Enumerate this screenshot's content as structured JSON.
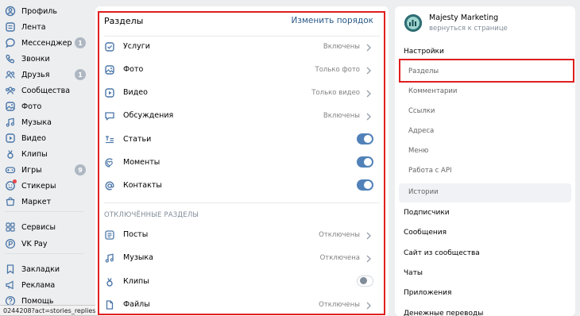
{
  "left_nav": {
    "items": [
      {
        "label": "Профиль",
        "icon": "user-circle-icon"
      },
      {
        "label": "Лента",
        "icon": "news-icon"
      },
      {
        "label": "Мессенджер",
        "icon": "message-icon",
        "badge": "1"
      },
      {
        "label": "Звонки",
        "icon": "phone-icon"
      },
      {
        "label": "Друзья",
        "icon": "friends-icon",
        "badge": "1"
      },
      {
        "label": "Сообщества",
        "icon": "communities-icon"
      },
      {
        "label": "Фото",
        "icon": "photo-icon"
      },
      {
        "label": "Музыка",
        "icon": "music-icon"
      },
      {
        "label": "Видео",
        "icon": "video-icon"
      },
      {
        "label": "Клипы",
        "icon": "clips-icon"
      },
      {
        "label": "Игры",
        "icon": "games-icon",
        "badge": "9"
      },
      {
        "label": "Стикеры",
        "icon": "stickers-icon"
      },
      {
        "label": "Маркет",
        "icon": "market-icon"
      },
      {
        "label": "Сервисы",
        "icon": "services-icon"
      },
      {
        "label": "VK Pay",
        "icon": "vkpay-icon"
      },
      {
        "label": "Закладки",
        "icon": "bookmark-icon"
      },
      {
        "label": "Реклама",
        "icon": "ads-icon"
      },
      {
        "label": "Помощь",
        "icon": "help-icon"
      }
    ]
  },
  "status_bar": {
    "text": "0244208?act=stories_replies"
  },
  "sections_panel": {
    "title": "Разделы",
    "action": "Изменить порядок",
    "enabled_rows": [
      {
        "label": "Услуги",
        "value": "Включены",
        "icon": "services-check-icon"
      },
      {
        "label": "Фото",
        "value": "Только фото",
        "icon": "photo-icon"
      },
      {
        "label": "Видео",
        "value": "Только видео",
        "icon": "video-icon"
      },
      {
        "label": "Обсуждения",
        "value": "Включены",
        "icon": "discussions-icon"
      },
      {
        "label": "Статьи",
        "toggle": true,
        "icon": "articles-icon"
      },
      {
        "label": "Моменты",
        "toggle": true,
        "icon": "moments-icon"
      },
      {
        "label": "Контакты",
        "toggle": true,
        "icon": "contacts-icon"
      }
    ],
    "disabled_title": "ОТКЛЮЧЁННЫЕ РАЗДЕЛЫ",
    "disabled_rows": [
      {
        "label": "Посты",
        "value": "Отключены",
        "icon": "posts-icon"
      },
      {
        "label": "Музыка",
        "value": "Отключена",
        "icon": "music-icon"
      },
      {
        "label": "Клипы",
        "toggle": false,
        "icon": "clips-icon"
      },
      {
        "label": "Файлы",
        "value": "Отключены",
        "icon": "files-icon"
      }
    ]
  },
  "right_panel": {
    "community_name": "Majesty Marketing",
    "back_link": "вернуться к странице",
    "items": [
      {
        "label": "Настройки",
        "level": "top"
      },
      {
        "label": "Разделы",
        "level": "sub",
        "selected": true
      },
      {
        "label": "Комментарии",
        "level": "sub"
      },
      {
        "label": "Ссылки",
        "level": "sub"
      },
      {
        "label": "Адреса",
        "level": "sub"
      },
      {
        "label": "Меню",
        "level": "sub"
      },
      {
        "label": "Работа с API",
        "level": "sub"
      },
      {
        "label": "Истории",
        "level": "sub",
        "selected": true
      },
      {
        "label": "Подписчики",
        "level": "top"
      },
      {
        "label": "Сообщения",
        "level": "top"
      },
      {
        "label": "Сайт из сообщества",
        "level": "top"
      },
      {
        "label": "Чаты",
        "level": "top"
      },
      {
        "label": "Приложения",
        "level": "top"
      },
      {
        "label": "Денежные переводы",
        "level": "top"
      }
    ]
  },
  "colors": {
    "accent": "#4a76a8",
    "link": "#2a5885",
    "toggle_on": "#5181b8",
    "highlight_box": "#e01e1e"
  }
}
